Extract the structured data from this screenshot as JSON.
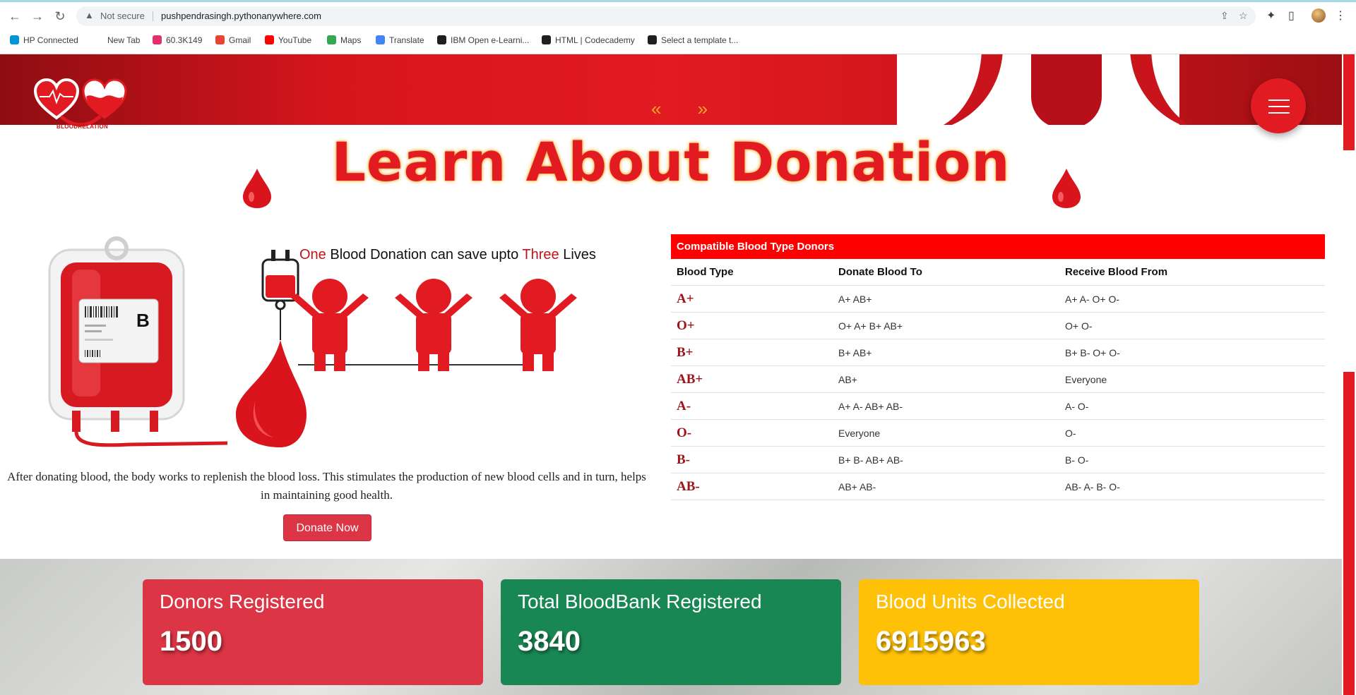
{
  "browser": {
    "security_label": "Not secure",
    "url": "pushpendrasingh.pythonanywhere.com",
    "bookmarks": [
      {
        "label": "HP Connected",
        "color": "#0096d6"
      },
      {
        "label": "New Tab",
        "color": "#ffffff"
      },
      {
        "label": "60.3K149",
        "color": "#e1306c"
      },
      {
        "label": "Gmail",
        "color": "#ea4335"
      },
      {
        "label": "YouTube",
        "color": "#ff0000"
      },
      {
        "label": "Maps",
        "color": "#34a853"
      },
      {
        "label": "Translate",
        "color": "#4285f4"
      },
      {
        "label": "IBM Open e-Learni...",
        "color": "#1f1f1f"
      },
      {
        "label": "HTML | Codecademy",
        "color": "#1f1f1f"
      },
      {
        "label": "Select a template t...",
        "color": "#1f1f1f"
      }
    ]
  },
  "header": {
    "logo_text": "BLOODRELATION",
    "nav_arrows": "« »"
  },
  "main": {
    "heading": "Learn About Donation",
    "caption": {
      "part1": "One",
      "part2": " Blood Donation can save upto ",
      "part3": "Three",
      "part4": " Lives"
    },
    "bag_label": "B",
    "paragraph": "After donating blood, the body works to replenish the blood loss. This stimulates the production of new blood cells and in turn, helps in maintaining good health.",
    "donate_button": "Donate Now"
  },
  "table": {
    "title": "Compatible Blood Type Donors",
    "headers": [
      "Blood Type",
      "Donate Blood To",
      "Receive Blood From"
    ],
    "rows": [
      [
        "A+",
        "A+ AB+",
        "A+ A- O+ O-"
      ],
      [
        "O+",
        "O+ A+ B+ AB+",
        "O+ O-"
      ],
      [
        "B+",
        "B+ AB+",
        "B+ B- O+ O-"
      ],
      [
        "AB+",
        "AB+",
        "Everyone"
      ],
      [
        "A-",
        "A+ A- AB+ AB-",
        "A- O-"
      ],
      [
        "O-",
        "Everyone",
        "O-"
      ],
      [
        "B-",
        "B+ B- AB+ AB-",
        "B- O-"
      ],
      [
        "AB-",
        "AB+ AB-",
        "AB- A- B- O-"
      ]
    ]
  },
  "stats": [
    {
      "title": "Donors Registered",
      "value": "1500",
      "color": "#dc3545"
    },
    {
      "title": "Total BloodBank Registered",
      "value": "3840",
      "color": "#198754"
    },
    {
      "title": "Blood Units Collected",
      "value": "6915963",
      "color": "#ffc107"
    }
  ]
}
